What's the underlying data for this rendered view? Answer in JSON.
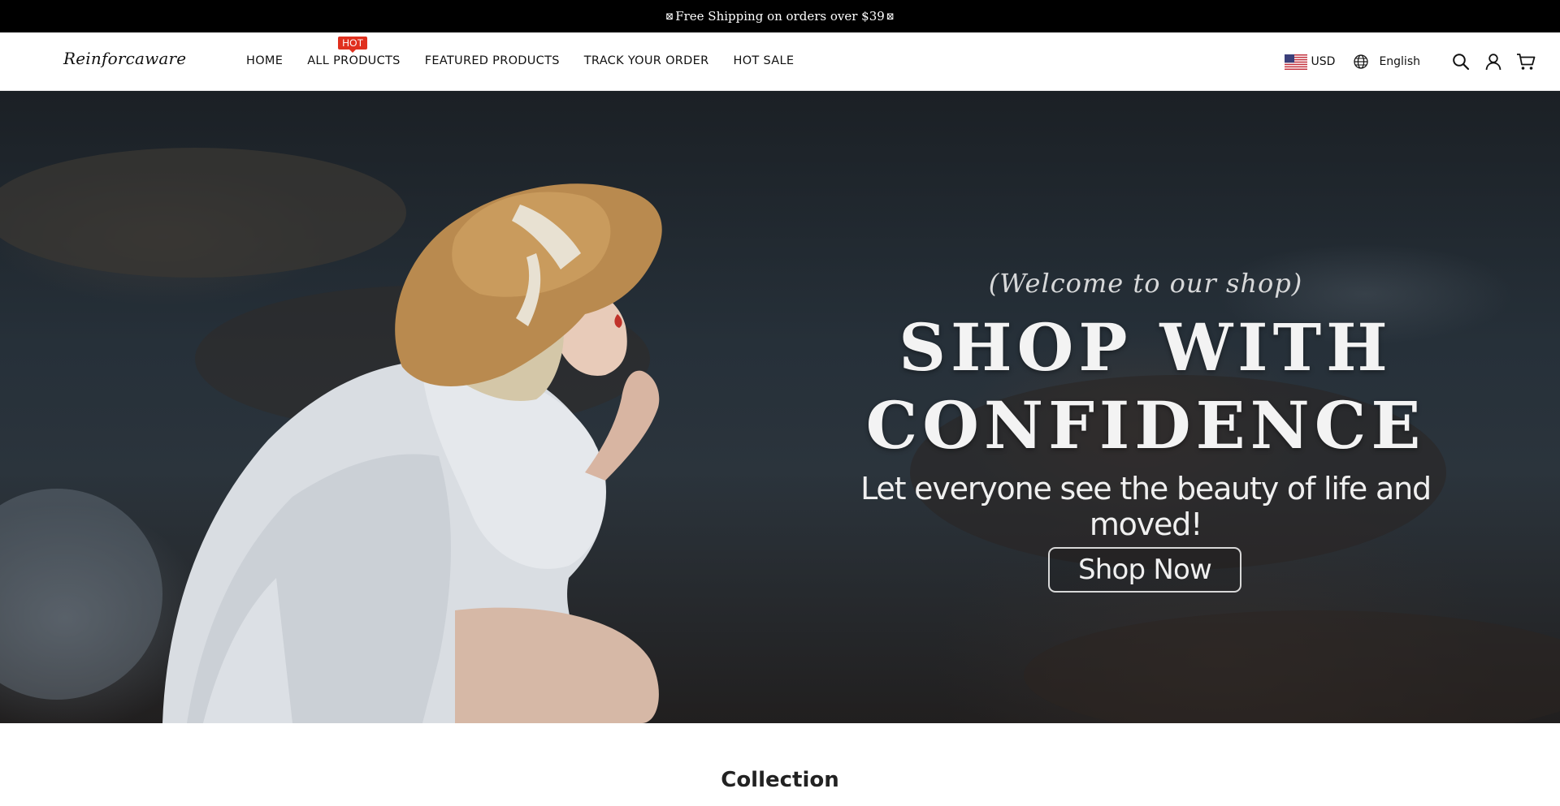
{
  "announcement": {
    "box_glyph": "⊠",
    "text": "Free Shipping on orders over $39"
  },
  "header": {
    "logo": "Reinforcaware",
    "nav": [
      {
        "label": "HOME"
      },
      {
        "label": "ALL PRODUCTS",
        "badge": "HOT"
      },
      {
        "label": "FEATURED PRODUCTS"
      },
      {
        "label": "TRACK YOUR ORDER"
      },
      {
        "label": "HOT SALE"
      }
    ],
    "currency": "USD",
    "language": "English",
    "icons": [
      "us-flag-icon",
      "globe-icon",
      "search-icon",
      "account-icon",
      "cart-icon"
    ]
  },
  "hero": {
    "welcome": "(Welcome to our shop)",
    "headline_line1": "SHOP WITH",
    "headline_line2": "CONFIDENCE",
    "subline": "Let everyone see the beauty of life and moved!",
    "cta": "Shop Now"
  },
  "collection": {
    "title": "Collection"
  },
  "colors": {
    "announcement_bg": "#000000",
    "badge": "#e0301e",
    "hero_bg": "#263039"
  }
}
